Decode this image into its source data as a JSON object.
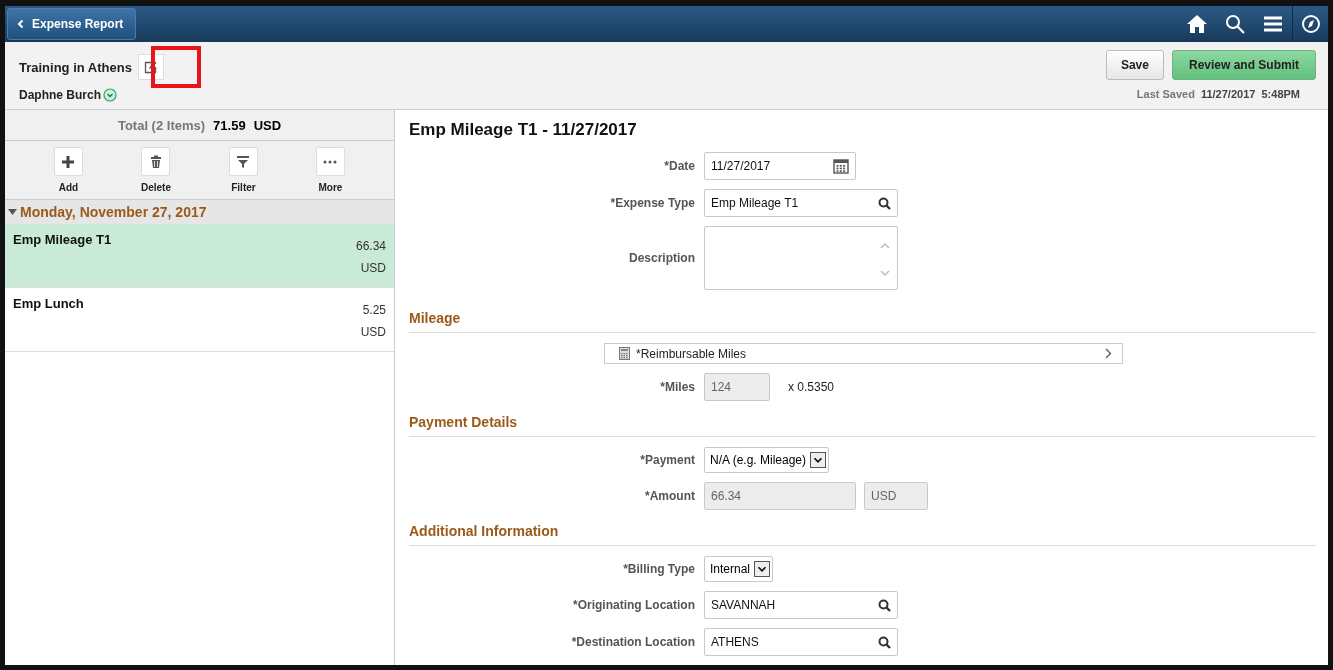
{
  "header": {
    "back_button": "Expense Report"
  },
  "report": {
    "title": "Training in Athens",
    "highlighted": true,
    "employee": "Daphne Burch"
  },
  "actions": [
    {
      "label": "Save",
      "kind": "secondary"
    },
    {
      "label": "Review and Submit",
      "kind": "primary"
    }
  ],
  "last_saved": {
    "label": "Last Saved",
    "value": "11/27/2017  5:48PM"
  },
  "summary": {
    "label": "Total (2 Items)",
    "amount": "71.59",
    "currency": "USD"
  },
  "toolbar": [
    {
      "label": "Add",
      "kind": "add"
    },
    {
      "label": "Delete",
      "kind": "delete"
    },
    {
      "label": "Filter",
      "kind": "filter"
    },
    {
      "label": "More",
      "kind": "more"
    }
  ],
  "groups": [
    {
      "title": "Monday, November 27, 2017",
      "expanded": true,
      "items": [
        {
          "name": "Emp Mileage T1",
          "amount": "66.34",
          "currency": "USD",
          "selected": true
        },
        {
          "name": "Emp Lunch",
          "amount": "5.25",
          "currency": "USD",
          "selected": false
        }
      ]
    }
  ],
  "detail": {
    "title": "Emp Mileage T1 - 11/27/2017",
    "sections": [
      {
        "fields": [
          {
            "kind": "date",
            "label": "*Date",
            "value": "11/27/2017"
          },
          {
            "kind": "lookup",
            "label": "*Expense Type",
            "value": "Emp Mileage T1"
          },
          {
            "kind": "textarea",
            "label": "Description"
          }
        ]
      },
      {
        "title": "Mileage",
        "fields": [
          {
            "kind": "link",
            "label": "*Reimbursable Miles"
          },
          {
            "kind": "readonly-rate",
            "label": "*Miles",
            "value": "124",
            "rate": "x  0.5350"
          }
        ]
      },
      {
        "title": "Payment Details",
        "fields": [
          {
            "kind": "select",
            "label": "*Payment",
            "value": "N/A (e.g. Mileage)"
          },
          {
            "kind": "amount",
            "label": "*Amount",
            "value": "66.34",
            "currency": "USD"
          }
        ]
      },
      {
        "title": "Additional Information",
        "fields": [
          {
            "kind": "select",
            "label": "*Billing Type",
            "value": "Internal"
          },
          {
            "kind": "lookup",
            "label": "*Originating Location",
            "value": "SAVANNAH"
          },
          {
            "kind": "lookup",
            "label": "*Destination Location",
            "value": "ATHENS"
          }
        ]
      }
    ]
  }
}
